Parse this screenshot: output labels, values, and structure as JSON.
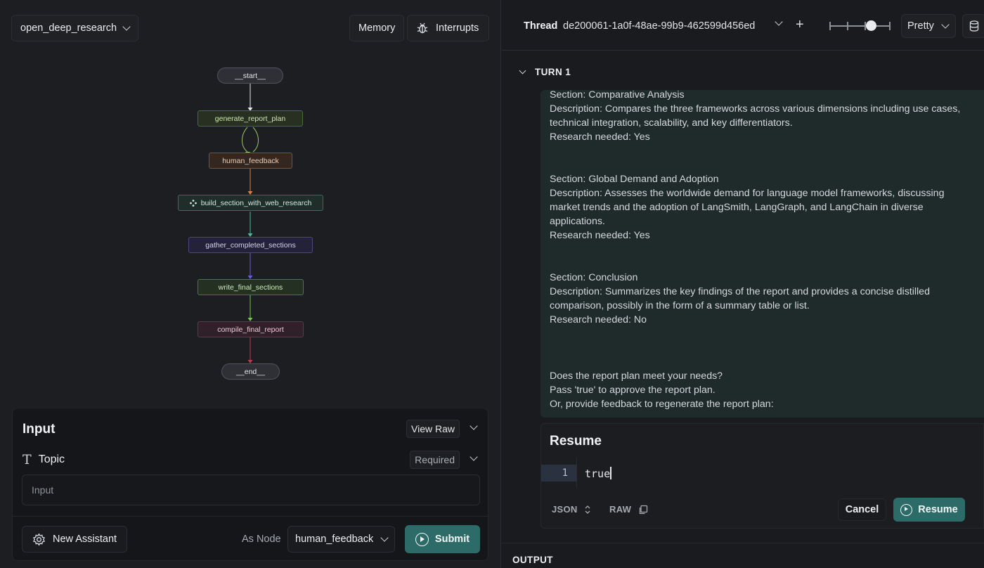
{
  "left": {
    "graph_name": "open_deep_research",
    "memory_label": "Memory",
    "interrupts_label": "Interrupts",
    "nodes": {
      "start": "__start__",
      "generate_report_plan": "generate_report_plan",
      "human_feedback": "human_feedback",
      "build_section_with_web_research": "build_section_with_web_research",
      "gather_completed_sections": "gather_completed_sections",
      "write_final_sections": "write_final_sections",
      "compile_final_report": "compile_final_report",
      "end": "__end__"
    },
    "input_card": {
      "title": "Input",
      "view_raw_label": "View Raw",
      "topic_label": "Topic",
      "required_label": "Required",
      "topic_placeholder": "Input",
      "new_assistant_label": "New Assistant",
      "as_node_label": "As Node",
      "as_node_value": "human_feedback",
      "submit_label": "Submit"
    }
  },
  "right": {
    "thread_label": "Thread",
    "thread_id": "de200061-1a0f-48ae-99b9-462599d456ed",
    "view_mode": "Pretty",
    "turn_label": "TURN 1",
    "message_text": "Section: Comparative Analysis\nDescription: Compares the three frameworks across various dimensions including use cases, technical integration, scalability, and key differentiators.\nResearch needed: Yes\n\n\nSection: Global Demand and Adoption\nDescription: Assesses the worldwide demand for language model frameworks, discussing market trends and the adoption of LangSmith, LangGraph, and LangChain in diverse applications.\nResearch needed: Yes\n\n\nSection: Conclusion\nDescription: Summarizes the key findings of the report and provides a concise distilled comparison, possibly in the form of a summary table or list.\nResearch needed: No\n\n\n\nDoes the report plan meet your needs?\nPass 'true' to approve the report plan.\nOr, provide feedback to regenerate the report plan:",
    "resume": {
      "title": "Resume",
      "line_number": "1",
      "editor_value": "true",
      "format_json": "JSON",
      "format_raw": "RAW",
      "cancel_label": "Cancel",
      "resume_label": "Resume"
    },
    "output_label": "OUTPUT"
  },
  "colors": {
    "accent_teal": "#2d6b68",
    "message_bg": "#1f2a2a"
  }
}
